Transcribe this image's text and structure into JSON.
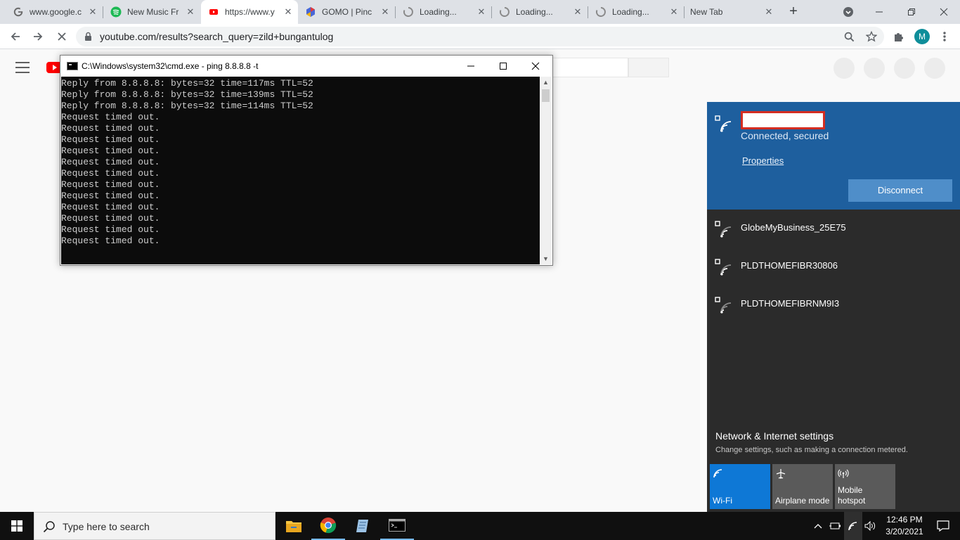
{
  "browser": {
    "tabs": [
      {
        "title": "www.google.c",
        "icon": "google-icon"
      },
      {
        "title": "New Music Fr",
        "icon": "spotify-icon"
      },
      {
        "title": "https://www.y",
        "icon": "youtube-loading-icon"
      },
      {
        "title": "GOMO | Pinc",
        "icon": "gomo-icon"
      },
      {
        "title": "Loading...",
        "icon": "spinner-icon"
      },
      {
        "title": "Loading...",
        "icon": "spinner-icon"
      },
      {
        "title": "Loading...",
        "icon": "spinner-icon"
      },
      {
        "title": "New Tab",
        "icon": "none"
      }
    ],
    "url": "youtube.com/results?search_query=zild+bungantulog",
    "profile_initial": "M"
  },
  "cmd": {
    "title": "C:\\Windows\\system32\\cmd.exe - ping  8.8.8.8 -t",
    "lines": [
      "Reply from 8.8.8.8: bytes=32 time=117ms TTL=52",
      "Reply from 8.8.8.8: bytes=32 time=139ms TTL=52",
      "Reply from 8.8.8.8: bytes=32 time=114ms TTL=52",
      "Request timed out.",
      "Request timed out.",
      "Request timed out.",
      "Request timed out.",
      "Request timed out.",
      "Request timed out.",
      "Request timed out.",
      "Request timed out.",
      "Request timed out.",
      "Request timed out.",
      "Request timed out.",
      "Request timed out."
    ]
  },
  "network": {
    "connected": {
      "status": "Connected, secured",
      "properties_label": "Properties",
      "disconnect_label": "Disconnect"
    },
    "networks": [
      {
        "ssid": "GlobeMyBusiness_25E75"
      },
      {
        "ssid": "PLDTHOMEFIBR30806"
      },
      {
        "ssid": "PLDTHOMEFIBRNM9I3"
      }
    ],
    "settings_title": "Network & Internet settings",
    "settings_subtitle": "Change settings, such as making a connection metered.",
    "quick_actions": [
      {
        "label": "Wi-Fi",
        "active": true
      },
      {
        "label": "Airplane mode",
        "active": false
      },
      {
        "label": "Mobile hotspot",
        "active": false
      }
    ]
  },
  "taskbar": {
    "search_placeholder": "Type here to search",
    "time": "12:46 PM",
    "date": "3/20/2021"
  }
}
